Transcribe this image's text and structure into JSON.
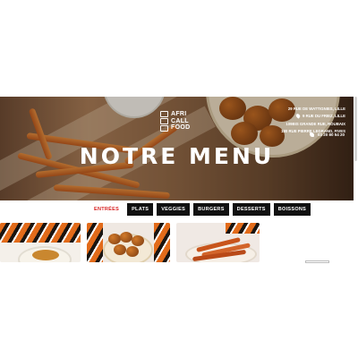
{
  "hero": {
    "title": "NOTRE MENU",
    "logo_lines": [
      "AFRI",
      "CALL",
      "FOOD"
    ],
    "locations": [
      "29 RUE DE WATTIGNIES, LILLE",
      "9 RUE DU FRIEZ, LILLE",
      "109BIS GRANDE RUE, ROUBAIX",
      "180 RUE PIERRE LEGRAND, FIVES"
    ],
    "phone": "03 20 80 54 20"
  },
  "tabs": [
    {
      "label": "ENTRÉES",
      "active": true
    },
    {
      "label": "PLATS",
      "active": false
    },
    {
      "label": "VEGGIES",
      "active": false
    },
    {
      "label": "BURGERS",
      "active": false
    },
    {
      "label": "DESSERTS",
      "active": false
    },
    {
      "label": "BOISSONS",
      "active": false
    }
  ],
  "colors": {
    "accent": "#d71f1f",
    "tab_bg": "#111111",
    "hero_text": "#ffffff"
  }
}
